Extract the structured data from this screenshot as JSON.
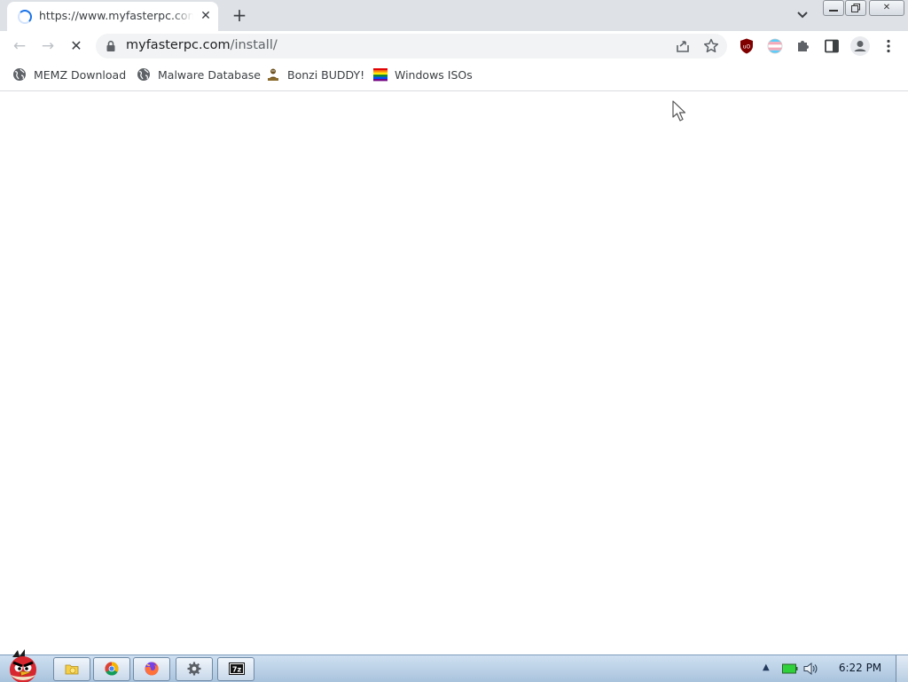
{
  "browser": {
    "tab": {
      "title": "https://www.myfasterpc.com/install/",
      "close_glyph": "✕",
      "icon": "loading-spinner-icon"
    },
    "new_tab_glyph": "+",
    "tab_search_icon": "chevron-down-icon",
    "window_controls": {
      "minimize_icon": "minimize-icon",
      "restore_icon": "restore-icon",
      "close_icon": "close-icon",
      "close_glyph": "✕"
    },
    "toolbar": {
      "back_glyph": "←",
      "forward_glyph": "→",
      "stop_glyph": "✕",
      "url_host": "myfasterpc.com",
      "url_path": "/install/",
      "icons": [
        "lock-icon",
        "share-icon",
        "star-icon",
        "ublock-icon",
        "extension-flag-icon",
        "puzzle-icon",
        "side-panel-icon",
        "profile-icon",
        "menu-icon"
      ]
    },
    "bookmarks": [
      {
        "label": "MEMZ Download",
        "icon": "globe-icon"
      },
      {
        "label": "Malware Database",
        "icon": "globe-icon"
      },
      {
        "label": "Bonzi BUDDY!",
        "icon": "bonzi-icon"
      },
      {
        "label": "Windows ISOs",
        "icon": "rainbow-flag-icon"
      }
    ]
  },
  "taskbar": {
    "start_icon": "angry-bird-icon",
    "apps": [
      {
        "name": "explorer",
        "icon": "folder-icon"
      },
      {
        "name": "chrome",
        "icon": "chrome-icon"
      },
      {
        "name": "firefox",
        "icon": "firefox-icon"
      },
      {
        "name": "settings",
        "icon": "gear-icon"
      },
      {
        "name": "7zip",
        "icon": "sevenzip-icon",
        "label": "7z"
      }
    ],
    "tray": {
      "arrow_glyph": "▲",
      "icons": [
        "battery-icon",
        "volume-icon"
      ],
      "time": "6:22 PM"
    }
  },
  "colors": {
    "tabstrip": "#dee1e6",
    "accent": "#1a73e8",
    "taskbar": "#a9c3dd"
  }
}
